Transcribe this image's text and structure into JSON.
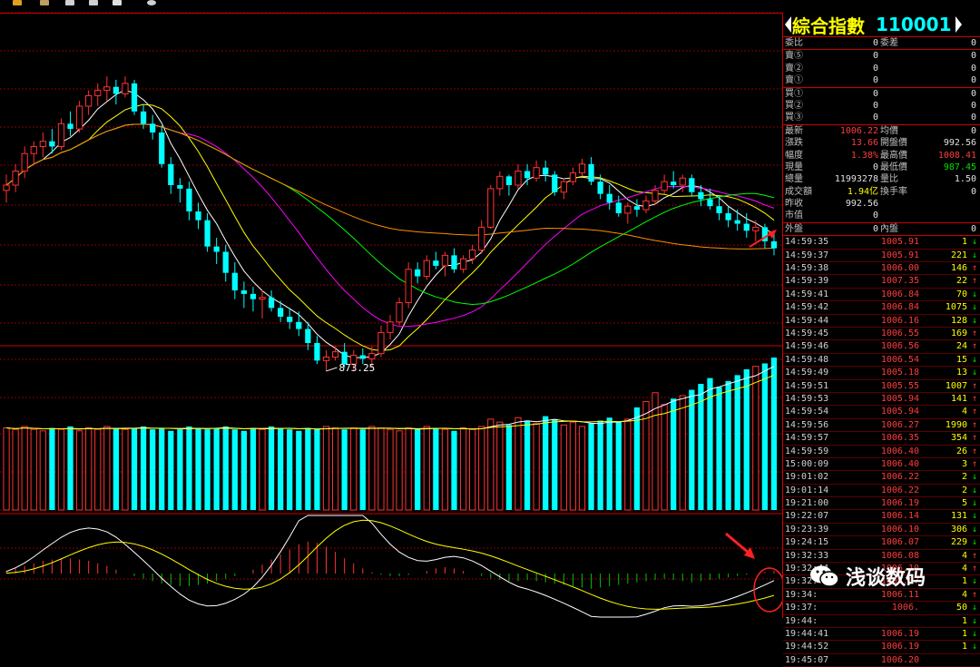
{
  "panel": {
    "title": "綜合指數",
    "code": "110001",
    "order_rows": [
      {
        "l1": "委比",
        "v1": "0",
        "l2": "委差",
        "v2": "0"
      }
    ],
    "sell_rows": [
      {
        "label": "賣⑤",
        "value": "0",
        "vol": "0"
      },
      {
        "label": "賣②",
        "value": "0",
        "vol": "0"
      },
      {
        "label": "賣①",
        "value": "0",
        "vol": "0"
      }
    ],
    "buy_rows": [
      {
        "label": "買①",
        "value": "0",
        "vol": "0"
      },
      {
        "label": "買②",
        "value": "0",
        "vol": "0"
      },
      {
        "label": "買③",
        "value": "0",
        "vol": "0"
      }
    ],
    "quote_rows": [
      {
        "l1": "最新",
        "v1": "1006.22",
        "c1": "red",
        "l2": "均價",
        "v2": "0",
        "c2": "wht"
      },
      {
        "l1": "漲跌",
        "v1": "13.66",
        "c1": "red",
        "l2": "開盤價",
        "v2": "992.56",
        "c2": "wht"
      },
      {
        "l1": "幅度",
        "v1": "1.38%",
        "c1": "red",
        "l2": "最高價",
        "v2": "1008.41",
        "c2": "red"
      },
      {
        "l1": "現量",
        "v1": "0",
        "c1": "wht",
        "l2": "最低價",
        "v2": "987.45",
        "c2": "grn"
      },
      {
        "l1": "總量",
        "v1": "11993278",
        "c1": "wht",
        "l2": "量比",
        "v2": "1.50",
        "c2": "wht"
      },
      {
        "l1": "成交額",
        "v1": "1.94亿",
        "c1": "yel",
        "l2": "換手率",
        "v2": "0",
        "c2": "wht"
      },
      {
        "l1": "昨收",
        "v1": "992.56",
        "c1": "wht",
        "l2": "",
        "v2": "",
        "c2": "wht"
      },
      {
        "l1": "市值",
        "v1": "0",
        "c1": "wht",
        "l2": "",
        "v2": "",
        "c2": "wht"
      }
    ],
    "outer_inner": {
      "l1": "外盤",
      "v1": "0",
      "l2": "內盤",
      "v2": "0"
    },
    "ticks": [
      {
        "time": "14:59:35",
        "price": "1005.91",
        "vol": "1",
        "dir": "↓"
      },
      {
        "time": "14:59:37",
        "price": "1005.91",
        "vol": "221",
        "dir": "↓"
      },
      {
        "time": "14:59:38",
        "price": "1006.00",
        "vol": "146",
        "dir": "↑"
      },
      {
        "time": "14:59:39",
        "price": "1007.35",
        "vol": "22",
        "dir": "↑"
      },
      {
        "time": "14:59:41",
        "price": "1006.84",
        "vol": "70",
        "dir": "↓"
      },
      {
        "time": "14:59:42",
        "price": "1006.84",
        "vol": "1075",
        "dir": "↓"
      },
      {
        "time": "14:59:44",
        "price": "1006.16",
        "vol": "128",
        "dir": "↓"
      },
      {
        "time": "14:59:45",
        "price": "1006.55",
        "vol": "169",
        "dir": "↑"
      },
      {
        "time": "14:59:46",
        "price": "1006.56",
        "vol": "24",
        "dir": "↑"
      },
      {
        "time": "14:59:48",
        "price": "1006.54",
        "vol": "15",
        "dir": "↓"
      },
      {
        "time": "14:59:49",
        "price": "1005.18",
        "vol": "13",
        "dir": "↓"
      },
      {
        "time": "14:59:51",
        "price": "1005.55",
        "vol": "1007",
        "dir": "↑"
      },
      {
        "time": "14:59:53",
        "price": "1005.94",
        "vol": "141",
        "dir": "↑"
      },
      {
        "time": "14:59:54",
        "price": "1005.94",
        "vol": "4",
        "dir": "↑"
      },
      {
        "time": "14:59:56",
        "price": "1006.27",
        "vol": "1990",
        "dir": "↑"
      },
      {
        "time": "14:59:57",
        "price": "1006.35",
        "vol": "354",
        "dir": "↑"
      },
      {
        "time": "14:59:59",
        "price": "1006.40",
        "vol": "26",
        "dir": "↑"
      },
      {
        "time": "15:00:09",
        "price": "1006.40",
        "vol": "3",
        "dir": "↑"
      },
      {
        "time": "19:01:02",
        "price": "1006.22",
        "vol": "2",
        "dir": "↓"
      },
      {
        "time": "19:01:14",
        "price": "1006.22",
        "vol": "2",
        "dir": "↓"
      },
      {
        "time": "19:21:00",
        "price": "1006.19",
        "vol": "5",
        "dir": "↓"
      },
      {
        "time": "19:22:07",
        "price": "1006.14",
        "vol": "131",
        "dir": "↓"
      },
      {
        "time": "19:23:39",
        "price": "1006.10",
        "vol": "306",
        "dir": "↓"
      },
      {
        "time": "19:24:15",
        "price": "1006.07",
        "vol": "229",
        "dir": "↓"
      },
      {
        "time": "19:32:33",
        "price": "1006.08",
        "vol": "4",
        "dir": "↑"
      },
      {
        "time": "19:32:44",
        "price": "1006.10",
        "vol": "4",
        "dir": "↑"
      },
      {
        "time": "19:32:46",
        "price": "1006.07",
        "vol": "1",
        "dir": "↓"
      },
      {
        "time": "19:34:",
        "price": "1006.11",
        "vol": "4",
        "dir": "↑"
      },
      {
        "time": "19:37:",
        "price": "1006.",
        "vol": "50",
        "dir": "↓"
      },
      {
        "time": "19:44:",
        "price": "",
        "vol": "1",
        "dir": "↓"
      },
      {
        "time": "19:44:41",
        "price": "1006.19",
        "vol": "1",
        "dir": "↓"
      },
      {
        "time": "19:44:52",
        "price": "1006.19",
        "vol": "1",
        "dir": "↓"
      },
      {
        "time": "19:45:07",
        "price": "1006.20",
        "vol": "",
        "dir": ""
      }
    ]
  },
  "chart": {
    "low_label": "873.25",
    "colors": {
      "up": "#ff3232",
      "down": "#00ffff",
      "ma5": "#ffffff",
      "ma10": "#ffff00",
      "ma20": "#ff00ff",
      "ma30": "#00ff00",
      "ma60": "#ff8c00",
      "grid": "#8b0000"
    }
  },
  "chart_data": {
    "type": "candlestick",
    "candles": [
      [
        947,
        956,
        940,
        950
      ],
      [
        950,
        962,
        946,
        958
      ],
      [
        958,
        972,
        954,
        968
      ],
      [
        968,
        975,
        962,
        972
      ],
      [
        972,
        980,
        966,
        975
      ],
      [
        975,
        982,
        968,
        972
      ],
      [
        972,
        988,
        970,
        985
      ],
      [
        985,
        992,
        978,
        982
      ],
      [
        982,
        998,
        980,
        995
      ],
      [
        995,
        1004,
        990,
        1001
      ],
      [
        1001,
        1008,
        995,
        1004
      ],
      [
        1004,
        1012,
        998,
        1006
      ],
      [
        1006,
        1010,
        996,
        1002
      ],
      [
        1002,
        1012,
        1000,
        1008
      ],
      [
        1008,
        1010,
        990,
        992
      ],
      [
        992,
        996,
        982,
        985
      ],
      [
        985,
        990,
        976,
        980
      ],
      [
        980,
        984,
        960,
        962
      ],
      [
        962,
        966,
        945,
        950
      ],
      [
        950,
        954,
        940,
        948
      ],
      [
        948,
        952,
        930,
        935
      ],
      [
        935,
        940,
        925,
        930
      ],
      [
        930,
        934,
        912,
        915
      ],
      [
        915,
        920,
        905,
        912
      ],
      [
        912,
        916,
        895,
        900
      ],
      [
        900,
        906,
        885,
        890
      ],
      [
        890,
        895,
        880,
        888
      ],
      [
        888,
        892,
        878,
        885
      ],
      [
        885,
        890,
        874,
        886
      ],
      [
        886,
        890,
        878,
        880
      ],
      [
        880,
        884,
        872,
        875
      ],
      [
        875,
        880,
        868,
        872
      ],
      [
        872,
        878,
        864,
        868
      ],
      [
        868,
        872,
        856,
        860
      ],
      [
        860,
        864,
        848,
        850
      ],
      [
        850,
        856,
        844,
        852
      ],
      [
        852,
        858,
        850,
        855
      ],
      [
        855,
        860,
        846,
        848
      ],
      [
        848,
        856,
        844,
        853
      ],
      [
        853,
        857,
        848,
        851
      ],
      [
        851,
        858,
        846,
        854
      ],
      [
        854,
        870,
        852,
        866
      ],
      [
        866,
        876,
        862,
        872
      ],
      [
        872,
        886,
        870,
        883
      ],
      [
        883,
        906,
        880,
        902
      ],
      [
        902,
        906,
        894,
        898
      ],
      [
        898,
        910,
        896,
        907
      ],
      [
        907,
        912,
        902,
        904
      ],
      [
        904,
        912,
        898,
        910
      ],
      [
        910,
        914,
        900,
        902
      ],
      [
        902,
        910,
        900,
        908
      ],
      [
        908,
        916,
        905,
        913
      ],
      [
        913,
        930,
        911,
        926
      ],
      [
        926,
        950,
        925,
        948
      ],
      [
        948,
        958,
        944,
        955
      ],
      [
        955,
        956,
        944,
        950
      ],
      [
        950,
        962,
        948,
        958
      ],
      [
        958,
        962,
        950,
        954
      ],
      [
        954,
        964,
        952,
        960
      ],
      [
        960,
        964,
        952,
        956
      ],
      [
        956,
        958,
        944,
        946
      ],
      [
        946,
        954,
        942,
        952
      ],
      [
        952,
        960,
        950,
        957
      ],
      [
        957,
        965,
        955,
        962
      ],
      [
        962,
        966,
        950,
        952
      ],
      [
        952,
        956,
        942,
        945
      ],
      [
        945,
        950,
        936,
        940
      ],
      [
        940,
        944,
        932,
        934
      ],
      [
        934,
        940,
        928,
        938
      ],
      [
        938,
        942,
        932,
        936
      ],
      [
        936,
        944,
        934,
        941
      ],
      [
        941,
        950,
        939,
        947
      ],
      [
        947,
        956,
        945,
        952
      ],
      [
        952,
        958,
        948,
        950
      ],
      [
        950,
        956,
        946,
        954
      ],
      [
        954,
        956,
        944,
        946
      ],
      [
        946,
        950,
        938,
        942
      ],
      [
        942,
        948,
        936,
        938
      ],
      [
        938,
        944,
        930,
        934
      ],
      [
        934,
        938,
        926,
        930
      ],
      [
        930,
        936,
        924,
        928
      ],
      [
        928,
        934,
        920,
        924
      ],
      [
        924,
        930,
        918,
        926
      ],
      [
        926,
        928,
        914,
        918
      ],
      [
        918,
        922,
        910,
        914
      ]
    ],
    "volumes": [
      56,
      55,
      57,
      55,
      54,
      56,
      55,
      57,
      54,
      56,
      55,
      57,
      56,
      55,
      56,
      57,
      55,
      56,
      54,
      55,
      57,
      56,
      55,
      56,
      57,
      55,
      54,
      56,
      55,
      57,
      56,
      55,
      54,
      56,
      55,
      57,
      56,
      55,
      56,
      55,
      57,
      56,
      55,
      54,
      56,
      55,
      57,
      56,
      55,
      54,
      56,
      55,
      57,
      62,
      60,
      58,
      63,
      61,
      59,
      64,
      62,
      58,
      60,
      57,
      59,
      61,
      63,
      60,
      62,
      70,
      74,
      80,
      72,
      76,
      78,
      82,
      86,
      90,
      84,
      88,
      92,
      96,
      98,
      100,
      104
    ],
    "macd": [
      0.2,
      0.4,
      0.6,
      0.8,
      1.0,
      1.1,
      1.2,
      1.2,
      1.1,
      1.0,
      0.8,
      0.6,
      0.3,
      0.0,
      -0.2,
      -0.4,
      -0.6,
      -0.8,
      -0.9,
      -1.0,
      -1.0,
      -0.9,
      -0.8,
      -0.6,
      -0.4,
      -0.2,
      0.0,
      0.3,
      0.7,
      1.1,
      1.5,
      1.9,
      2.3,
      2.5,
      2.4,
      2.1,
      1.7,
      1.2,
      0.8,
      0.4,
      0.1,
      -0.1,
      -0.2,
      -0.2,
      -0.1,
      0.0,
      0.2,
      0.4,
      0.5,
      0.4,
      0.2,
      0.0,
      -0.2,
      -0.4,
      -0.5,
      -0.6,
      -0.6,
      -0.5,
      -0.6,
      -0.7,
      -0.8,
      -0.9,
      -1.0,
      -1.1,
      -1.2,
      -1.1,
      -1.0,
      -0.9,
      -0.8,
      -0.7,
      -0.6,
      -0.5,
      -0.4,
      -0.5,
      -0.6,
      -0.7,
      -0.6,
      -0.5,
      -0.4,
      -0.3,
      -0.2,
      -0.1,
      0.0,
      0.1,
      0.2
    ],
    "ylim": [
      860,
      1010
    ]
  },
  "watermark": {
    "text": "浅谈数码",
    "icon": "wechat-icon"
  }
}
